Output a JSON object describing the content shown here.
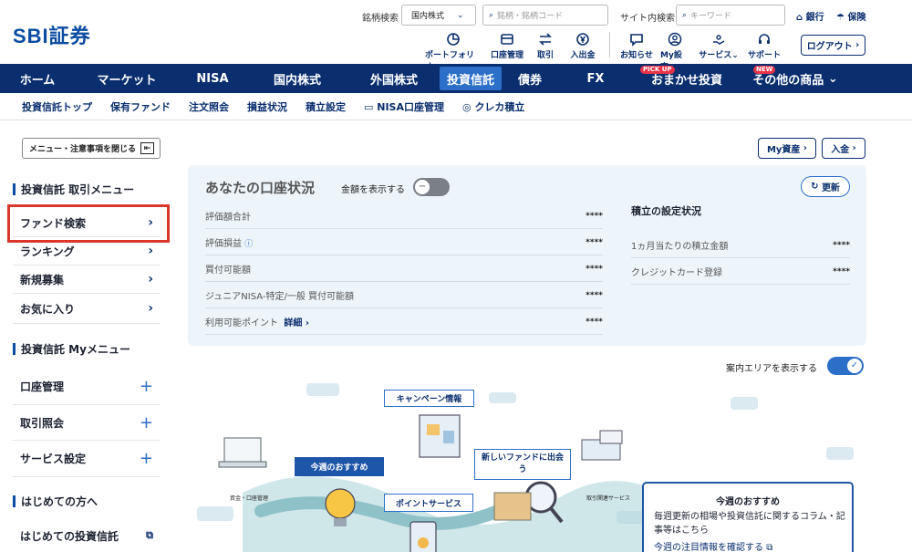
{
  "header": {
    "logo": "SBI証券",
    "stock_search_label": "銘柄検索",
    "market_select": "国内株式",
    "stock_search_placeholder": "銘柄・銘柄コード",
    "site_search_label": "サイト内検索",
    "site_search_placeholder": "キーワード",
    "bank_link": "銀行",
    "insurance_link": "保険",
    "util": [
      "ポートフォリオ",
      "口座管理",
      "取引",
      "入出金",
      "お知らせ",
      "My設定",
      "サービス",
      "サポート"
    ],
    "logout": "ログアウト"
  },
  "gnav": [
    {
      "label": "ホーム"
    },
    {
      "label": "マーケット"
    },
    {
      "label": "NISA"
    },
    {
      "label": "国内株式"
    },
    {
      "label": "外国株式"
    },
    {
      "label": "投資信託",
      "active": true
    },
    {
      "label": "債券"
    },
    {
      "label": "FX"
    },
    {
      "label": "おまかせ投資",
      "tag": "PICK UP"
    },
    {
      "label": "その他の商品",
      "tag": "NEW"
    }
  ],
  "subnav": [
    "投資信託トップ",
    "保有ファンド",
    "注文照会",
    "損益状況",
    "積立設定",
    "NISA口座管理",
    "クレカ積立"
  ],
  "sidebar": {
    "toggle": "メニュー・注意事項を閉じる",
    "trade_menu_title": "投資信託 取引メニュー",
    "trade_items": [
      "ファンド検索",
      "ランキング",
      "新規募集",
      "お気に入り"
    ],
    "my_menu_title": "投資信託 Myメニュー",
    "my_items": [
      "口座管理",
      "取引照会",
      "サービス設定"
    ],
    "beginner_title": "はじめての方へ",
    "beginner_item": "はじめての投資信託"
  },
  "actions": {
    "my_assets": "My資産",
    "deposit": "入金"
  },
  "account": {
    "title": "あなたの口座状況",
    "show_amount": "金額を表示する",
    "refresh": "更新",
    "rows": [
      {
        "label": "評価額合計",
        "value": "****"
      },
      {
        "label": "評価損益",
        "value": "****"
      },
      {
        "label": "買付可能額",
        "value": "****"
      },
      {
        "label": "ジュニアNISA-特定/一般 買付可能額",
        "value": "****"
      },
      {
        "label": "利用可能ポイント",
        "link": "詳細",
        "value": "****"
      }
    ],
    "tsumitate_title": "積立の設定状況",
    "tsumitate_rows": [
      {
        "label": "1ヵ月当たりの積立金額",
        "value": "****"
      },
      {
        "label": "クレジットカード登録",
        "value": "****"
      }
    ]
  },
  "guide": {
    "toggle_label": "案内エリアを表示する",
    "bubbles": [
      "キャンペーン情報",
      "今週のおすすめ",
      "新しいファンドに出会う",
      "ポイントサービス"
    ],
    "small_labels": [
      "資金・口座管理",
      "取引関連サービス"
    ],
    "card_title": "今週のおすすめ",
    "card_text": "毎週更新の相場や投資信託に関するコラム・記事等はこちら",
    "card_link": "今週の注目情報を確認する"
  },
  "colors": {
    "navy": "#0a2e6e",
    "accent": "#2c6fc8",
    "highlight": "#d9372b",
    "panel": "#eef5fa"
  }
}
